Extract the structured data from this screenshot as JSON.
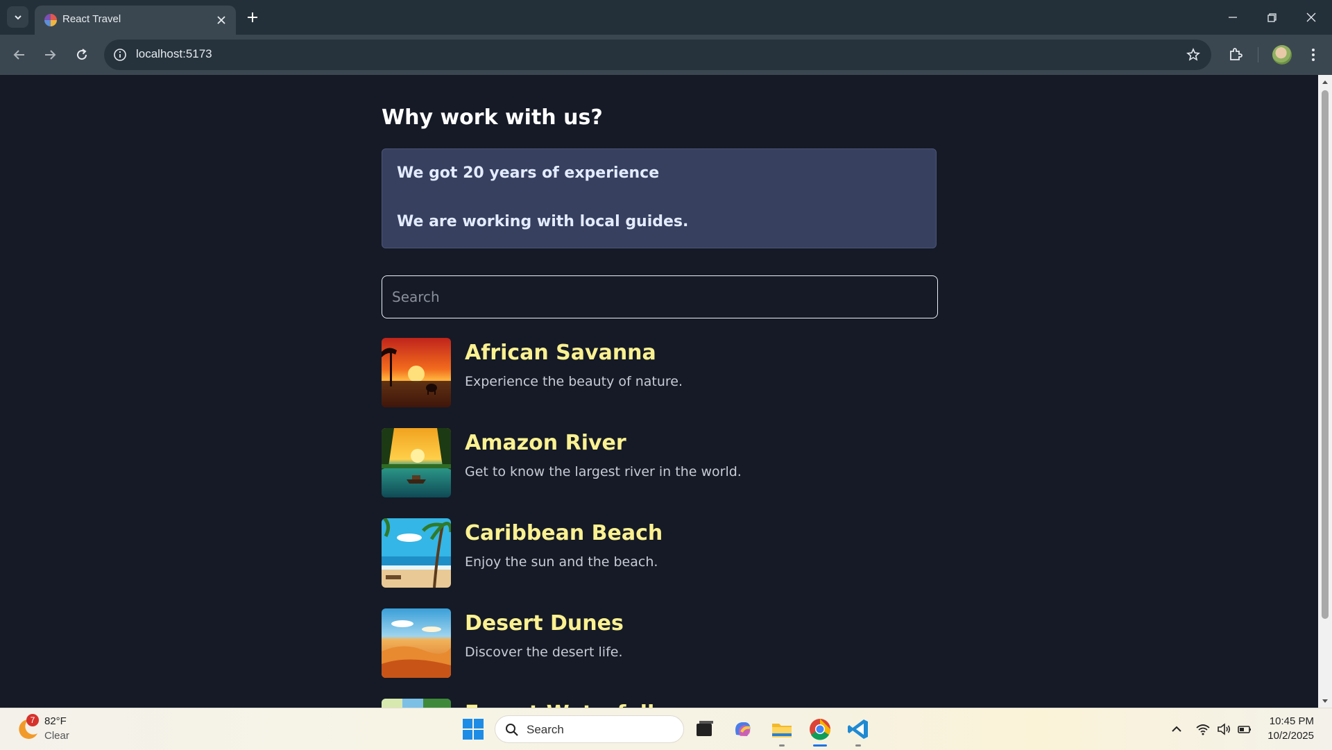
{
  "browser": {
    "tab_title": "React Travel",
    "url": "localhost:5173"
  },
  "page": {
    "heading": "Why work with us?",
    "features": [
      "We got 20 years of experience",
      "We are working with local guides."
    ],
    "search": {
      "placeholder": "Search",
      "value": ""
    },
    "destinations": [
      {
        "title": "African Savanna",
        "description": "Experience the beauty of nature.",
        "image": "savanna-sunset-image"
      },
      {
        "title": "Amazon River",
        "description": "Get to know the largest river in the world.",
        "image": "amazon-river-image"
      },
      {
        "title": "Caribbean Beach",
        "description": "Enjoy the sun and the beach.",
        "image": "caribbean-beach-image"
      },
      {
        "title": "Desert Dunes",
        "description": "Discover the desert life.",
        "image": "desert-dunes-image"
      },
      {
        "title": "Forest Waterfall",
        "description": "",
        "image": "forest-waterfall-image"
      }
    ]
  },
  "taskbar": {
    "weather": {
      "badge": "7",
      "temp": "82°F",
      "condition": "Clear"
    },
    "search_label": "Search",
    "clock": {
      "time": "10:45 PM",
      "date": "10/2/2025"
    }
  },
  "colors": {
    "page_bg": "#151a26",
    "feature_box_bg": "#37405f",
    "destination_title": "#fbf191",
    "browser_toolbar": "#3b4750"
  }
}
